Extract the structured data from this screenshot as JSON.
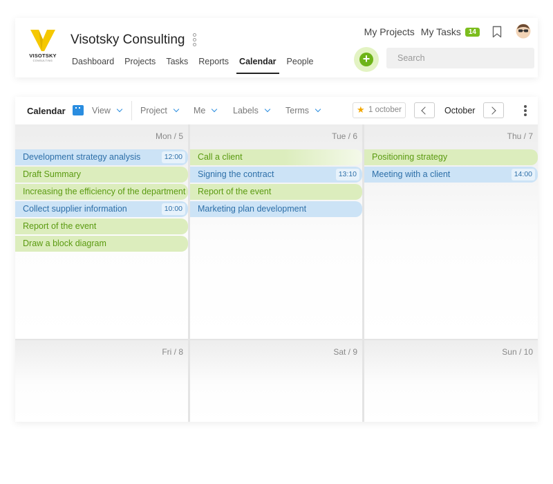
{
  "app": {
    "logo_text": "VISOTSKY",
    "logo_sub": "CONSULTING",
    "company_name": "Visotsky Consulting"
  },
  "nav": [
    "Dashboard",
    "Projects",
    "Tasks",
    "Reports",
    "Calendar",
    "People"
  ],
  "nav_active": "Calendar",
  "top_links": {
    "my_projects": "My Projects",
    "my_tasks": "My Tasks",
    "tasks_count": "14"
  },
  "search": {
    "placeholder": "Search"
  },
  "colors": {
    "accent_green": "#6eb418",
    "accent_blue": "#2a8de0",
    "badge_green": "#7cbd1e",
    "logo_yellow": "#f5c800"
  },
  "calendar": {
    "title": "Calendar",
    "filters": [
      "View",
      "Project",
      "Me",
      "Labels",
      "Terms"
    ],
    "favorite_label": "1 october",
    "month": "October",
    "days": [
      {
        "label": "Mon / 5",
        "events": [
          {
            "title": "Development strategy analysis",
            "time": "12:00",
            "color": "blue"
          },
          {
            "title": "Draft Summary",
            "time": "",
            "color": "green"
          },
          {
            "title": "Increasing the efficiency of the department",
            "time": "",
            "color": "green"
          },
          {
            "title": "Collect supplier information",
            "time": "10:00",
            "color": "blue"
          },
          {
            "title": "Report of the event",
            "time": "",
            "color": "green"
          },
          {
            "title": "Draw a block diagram",
            "time": "",
            "color": "green"
          }
        ]
      },
      {
        "label": "Tue / 6",
        "events": [
          {
            "title": "Call a client",
            "time": "",
            "color": "green"
          },
          {
            "title": "Signing the contract",
            "time": "13:10",
            "color": "blue"
          },
          {
            "title": "Report of the event",
            "time": "",
            "color": "green"
          },
          {
            "title": "Marketing plan development",
            "time": "",
            "color": "blue"
          }
        ]
      },
      {
        "label": "Thu / 7",
        "events": [
          {
            "title": "Positioning strategy",
            "time": "",
            "color": "green"
          },
          {
            "title": "Meeting with a client",
            "time": "14:00",
            "color": "blue"
          }
        ]
      },
      {
        "label": "Fri / 8",
        "events": []
      },
      {
        "label": "Sat / 9",
        "events": []
      },
      {
        "label": "Sun / 10",
        "events": []
      }
    ]
  }
}
